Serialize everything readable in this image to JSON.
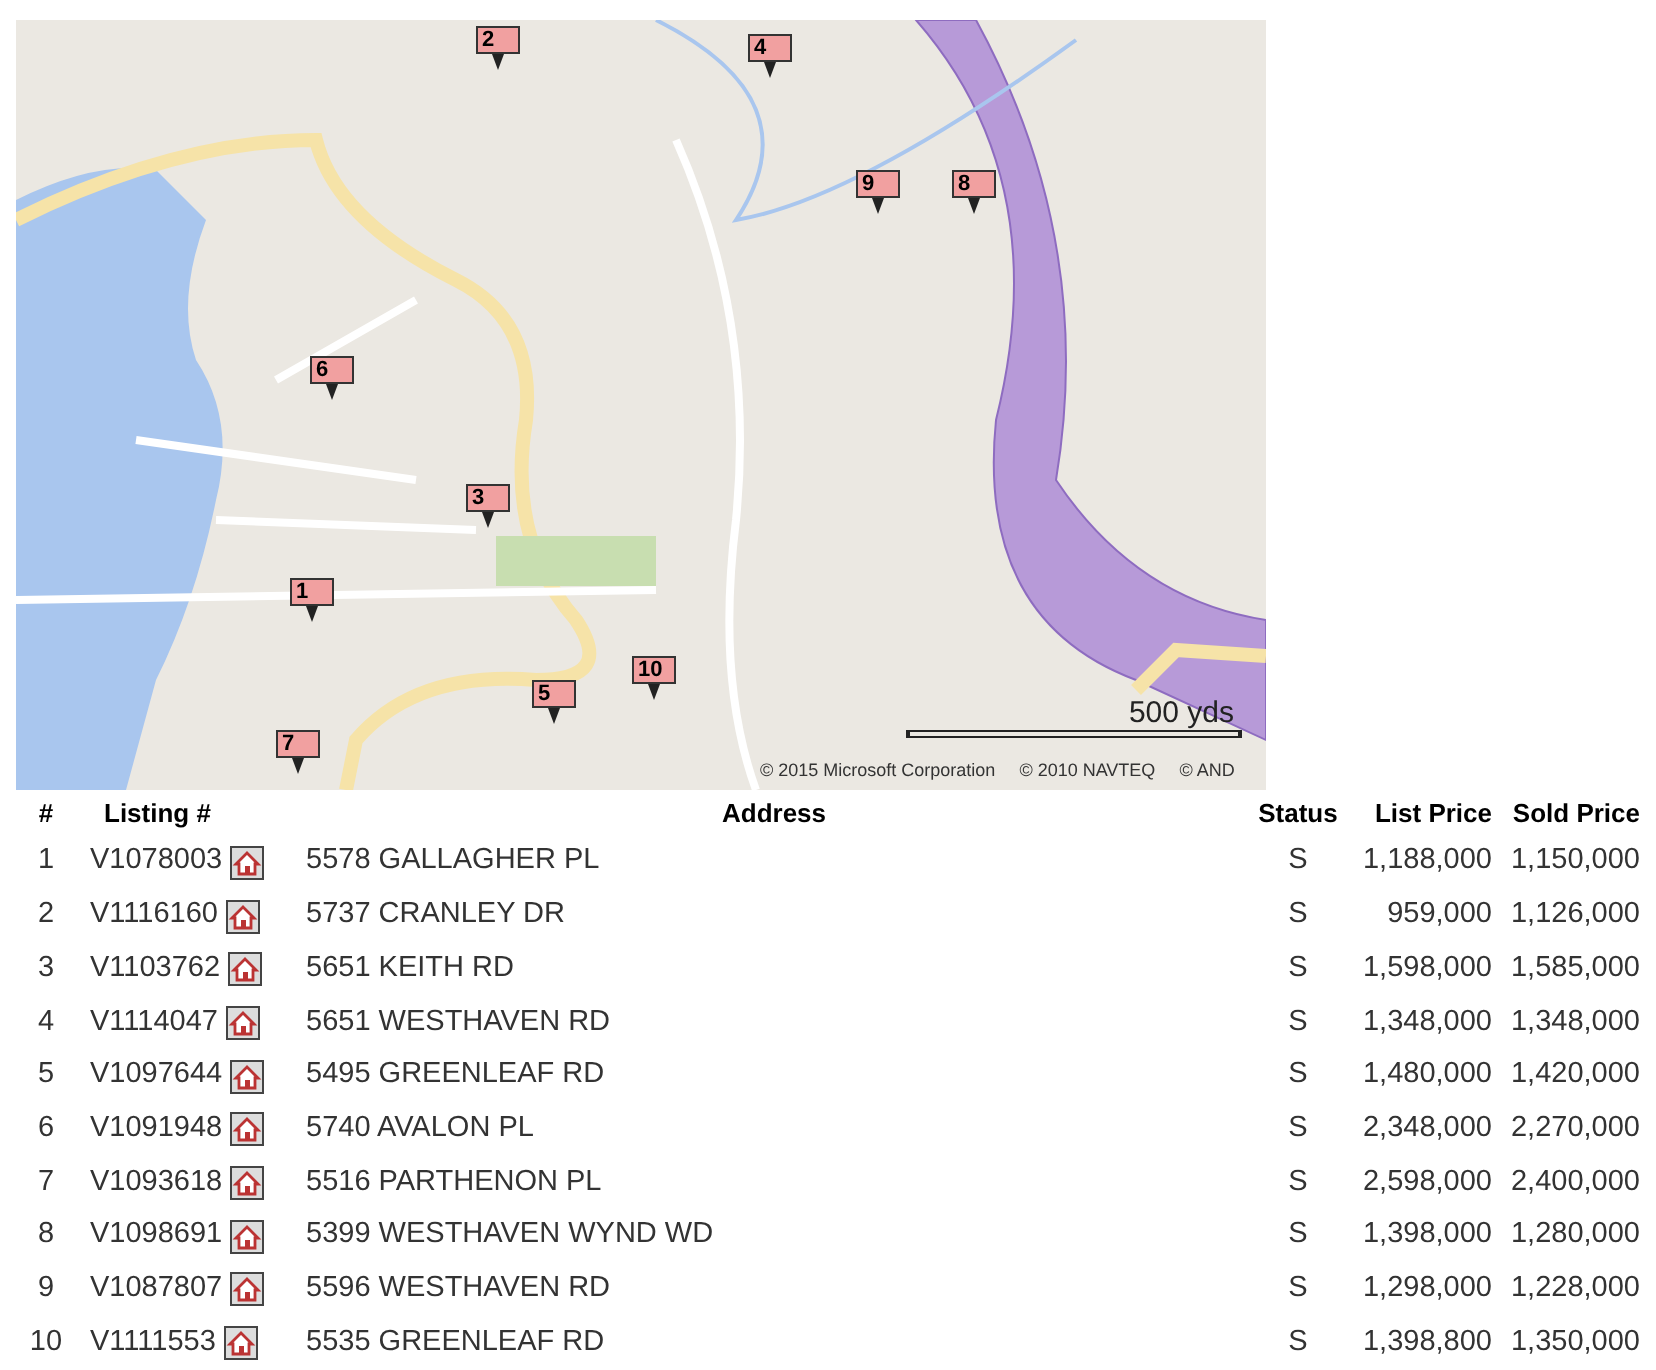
{
  "map": {
    "markers": [
      "1",
      "2",
      "3",
      "4",
      "5",
      "6",
      "7",
      "8",
      "9",
      "10"
    ],
    "scale": "500 yds",
    "copyright": [
      "© 2015 Microsoft Corporation",
      "© 2010 NAVTEQ",
      "© AND"
    ]
  },
  "table": {
    "columns": [
      "#",
      "Listing #",
      "Address",
      "Status",
      "List Price",
      "Sold Price"
    ],
    "rows": [
      [
        "1",
        "V1078003",
        "5578 GALLAGHER PL",
        "S",
        "1,188,000",
        "1,150,000"
      ],
      [
        "2",
        "V1116160",
        "5737 CRANLEY DR",
        "S",
        "959,000",
        "1,126,000"
      ],
      [
        "3",
        "V1103762",
        "5651 KEITH RD",
        "S",
        "1,598,000",
        "1,585,000"
      ],
      [
        "4",
        "V1114047",
        "5651 WESTHAVEN RD",
        "S",
        "1,348,000",
        "1,348,000"
      ],
      [
        "5",
        "V1097644",
        "5495 GREENLEAF RD",
        "S",
        "1,480,000",
        "1,420,000"
      ],
      [
        "6",
        "V1091948",
        "5740 AVALON PL",
        "S",
        "2,348,000",
        "2,270,000"
      ],
      [
        "7",
        "V1093618",
        "5516 PARTHENON PL",
        "S",
        "2,598,000",
        "2,400,000"
      ],
      [
        "8",
        "V1098691",
        "5399 WESTHAVEN WYND WD",
        "S",
        "1,398,000",
        "1,280,000"
      ],
      [
        "9",
        "V1087807",
        "5596 WESTHAVEN RD",
        "S",
        "1,298,000",
        "1,228,000"
      ],
      [
        "10",
        "V1111553",
        "5535 GREENLEAF RD",
        "S",
        "1,398,800",
        "1,350,000"
      ]
    ]
  }
}
